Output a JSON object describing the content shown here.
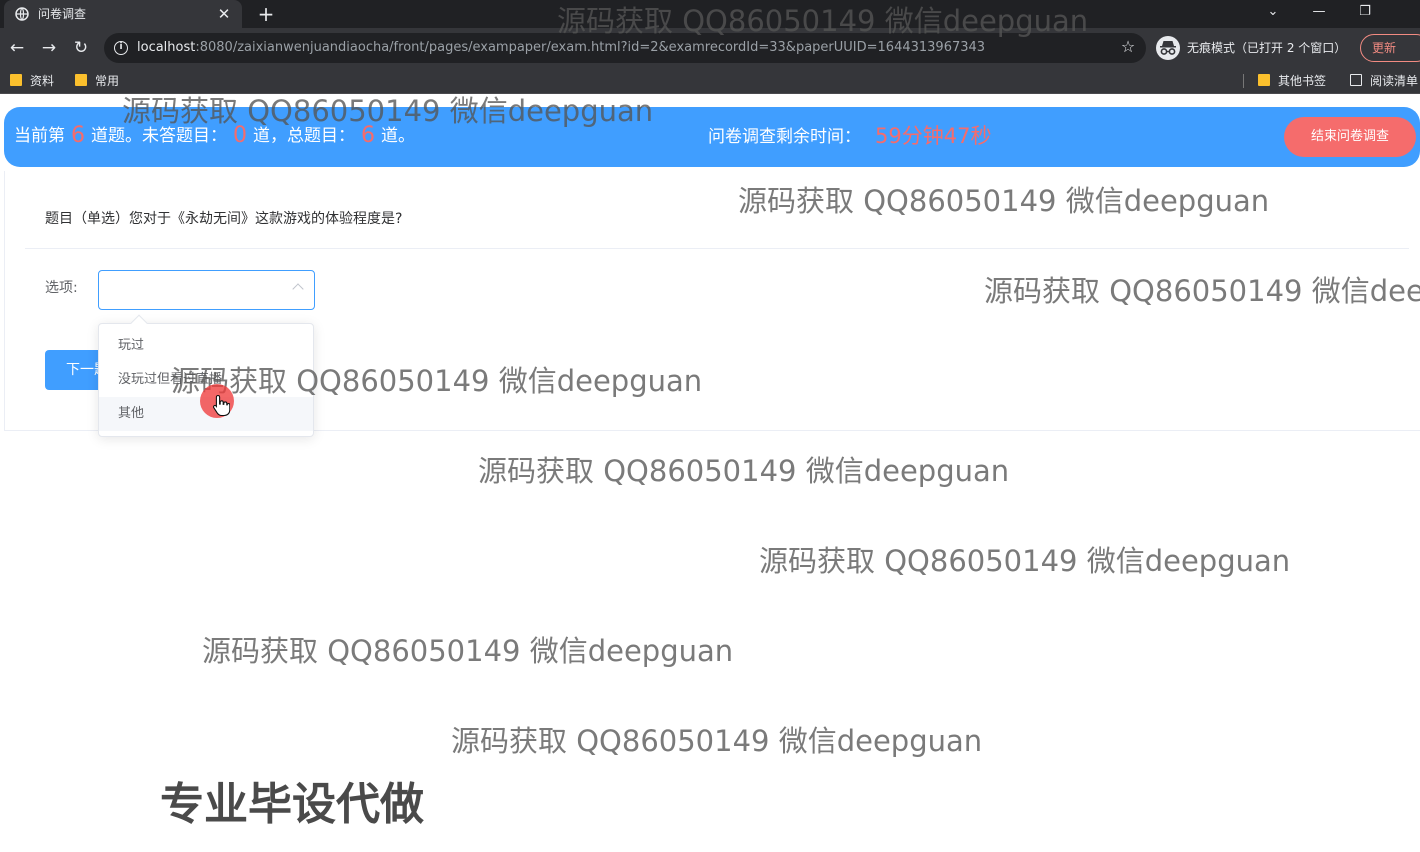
{
  "browser": {
    "tab_title": "问卷调查",
    "tab_close": "✕",
    "new_tab": "+",
    "url_host": "localhost",
    "url_rest": ":8080/zaixianwenjuandiaocha/front/pages/exampaper/exam.html?id=2&examrecordId=33&paperUUID=1644313967343",
    "incognito_label": "无痕模式（已打开 2 个窗口）",
    "update_label": "更新",
    "bookmarks": [
      "资料",
      "常用"
    ],
    "bookmarks_right": [
      "其他书签",
      "阅读清单"
    ]
  },
  "banner": {
    "current_prefix": "当前第",
    "current_num": "6",
    "current_mid": "道题。未答题目：",
    "unanswered_num": "0",
    "unanswered_suffix": "道，总题目：",
    "total_num": "6",
    "total_suffix": "道。",
    "timer_label": "问卷调查剩余时间：",
    "timer_value": "59分钟47秒",
    "end_button": "结束问卷调查"
  },
  "question": {
    "text": "题目（单选）您对于《永劫无间》这款游戏的体验程度是?",
    "option_label": "选项:",
    "select_value": "",
    "options": [
      "玩过",
      "没玩过但看过直播",
      "其他"
    ],
    "hovered_option": "其他",
    "next_button": "下一题"
  },
  "watermarks": {
    "text": "源码获取 QQ86050149 微信deepguan",
    "big_text": "专业毕设代做"
  },
  "colors": {
    "primary": "#409eff",
    "danger": "#f56c6c",
    "chrome_dark": "#202124",
    "chrome_mid": "#35363a"
  }
}
